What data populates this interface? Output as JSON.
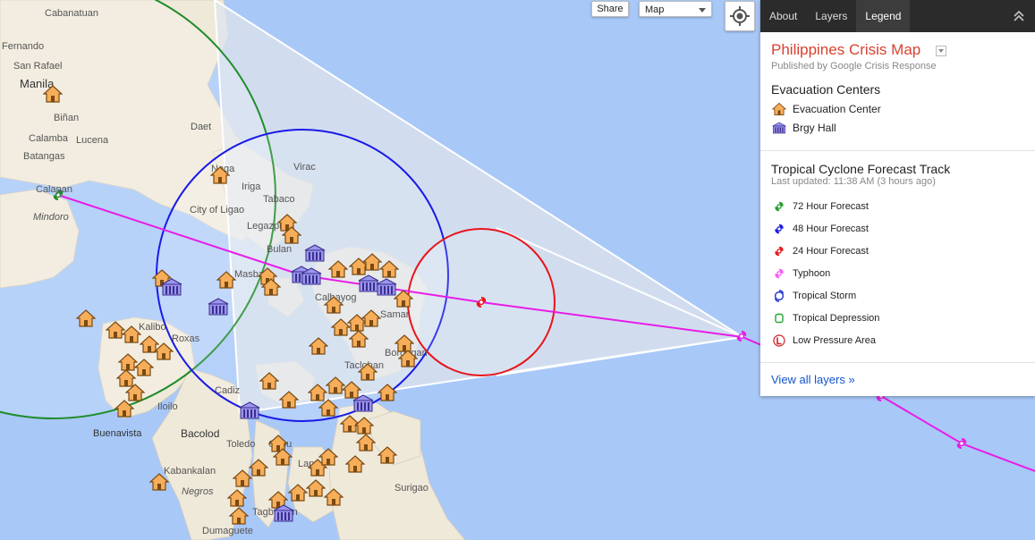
{
  "toolbar": {
    "share_label": "Share",
    "map_type": "Map"
  },
  "panel": {
    "tabs": [
      "About",
      "Layers",
      "Legend"
    ],
    "active_tab": "Legend",
    "title": "Philippines Crisis Map",
    "publisher": "Published by Google Crisis Response",
    "evacuation": {
      "heading": "Evacuation Centers",
      "items": [
        {
          "label": "Evacuation Center",
          "icon": "house-icon",
          "color": "#f7ae5a"
        },
        {
          "label": "Brgy Hall",
          "icon": "government-building-icon",
          "color": "#9b95f0"
        }
      ]
    },
    "cyclone": {
      "heading": "Tropical Cyclone Forecast Track",
      "updated": "Last updated: 11:38 AM (3 hours ago)",
      "items": [
        {
          "label": "72 Hour Forecast",
          "icon": "cyclone-72h-icon",
          "color": "#1f9c2e"
        },
        {
          "label": "48 Hour Forecast",
          "icon": "cyclone-48h-icon",
          "color": "#1a1ae8"
        },
        {
          "label": "24 Hour Forecast",
          "icon": "cyclone-24h-icon",
          "color": "#e8141a"
        },
        {
          "label": "Typhoon",
          "icon": "typhoon-icon",
          "color": "#ff55ff"
        },
        {
          "label": "Tropical Storm",
          "icon": "tropical-storm-icon",
          "color": "#2233cc"
        },
        {
          "label": "Tropical Depression",
          "icon": "tropical-depression-icon",
          "color": "#22a633"
        },
        {
          "label": "Low Pressure Area",
          "icon": "low-pressure-icon",
          "color": "#cc2222"
        }
      ]
    },
    "view_all": "View all layers »"
  },
  "map": {
    "place_labels": [
      "Cabanatuan",
      "Fernando",
      "San Rafael",
      "Manila",
      "Biñan",
      "Calamba",
      "Lucena",
      "Daet",
      "Batangas",
      "Calapan",
      "Mindoro",
      "Virac",
      "Naga",
      "Iriga",
      "Tabaco",
      "City of Ligao",
      "Legazpi",
      "Bulan",
      "Masbate",
      "Calbayog",
      "Samar",
      "Roxas",
      "Kalibo",
      "Cadiz",
      "Iloilo",
      "Buenavista",
      "Bacolod",
      "Toledo",
      "Kabankalan",
      "Negros",
      "Cebu",
      "Lapu",
      "Tagbilaran",
      "Dumaguete",
      "Surigao",
      "Borongan",
      "Tacloban"
    ],
    "colors": {
      "land": "#efe9da",
      "sea": "#a8c8f8",
      "cone": "#dde4ee",
      "track": "#e81ce8"
    }
  }
}
